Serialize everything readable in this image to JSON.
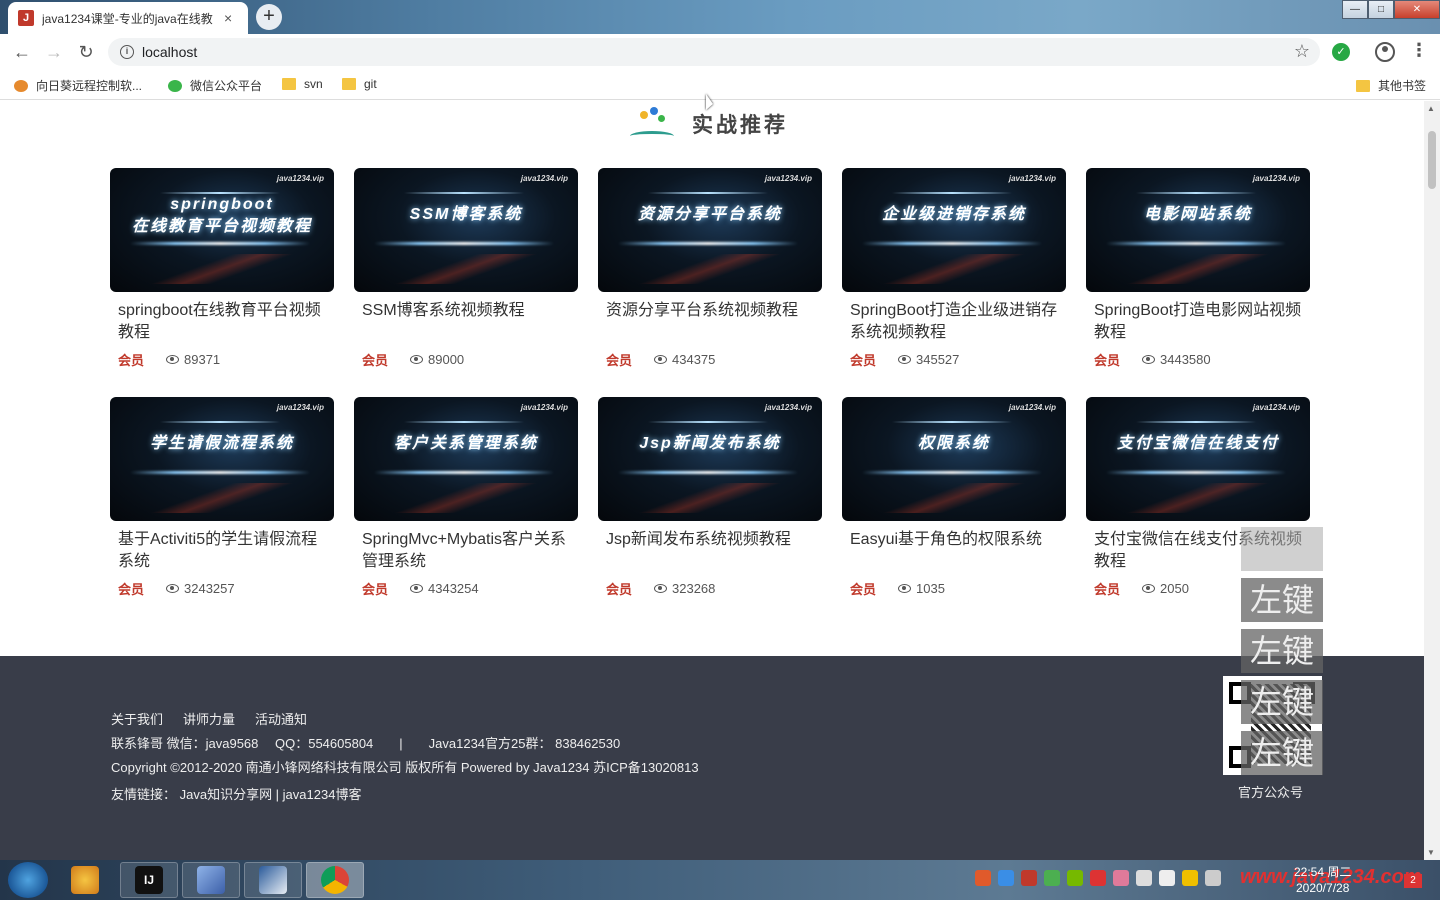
{
  "browser": {
    "tab_title": "java1234课堂-专业的java在线教",
    "tab_favicon": "J",
    "tab_close": "×",
    "new_tab": "+",
    "url": "localhost",
    "window_controls": {
      "minimize": "—",
      "maximize": "□",
      "close": "✕"
    }
  },
  "bookmarks": [
    {
      "label": "向日葵远程控制软...",
      "icon": "sunflower-icon"
    },
    {
      "label": "微信公众平台",
      "icon": "wechat-icon"
    },
    {
      "label": "svn",
      "icon": "folder-icon"
    },
    {
      "label": "git",
      "icon": "folder-icon"
    }
  ],
  "other_bookmarks": "其他书签",
  "section": {
    "title": "实战推荐"
  },
  "courses": [
    {
      "thumb": "springboot\n在线教育平台视频教程",
      "title": "springboot在线教育平台视频教程",
      "badge": "会员",
      "views": "89371"
    },
    {
      "thumb": "SSM博客系统",
      "title": "SSM博客系统视频教程",
      "badge": "会员",
      "views": "89000"
    },
    {
      "thumb": "资源分享平台系统",
      "title": "资源分享平台系统视频教程",
      "badge": "会员",
      "views": "434375"
    },
    {
      "thumb": "企业级进销存系统",
      "title": "SpringBoot打造企业级进销存系统视频教程",
      "badge": "会员",
      "views": "345527"
    },
    {
      "thumb": "电影网站系统",
      "title": "SpringBoot打造电影网站视频教程",
      "badge": "会员",
      "views": "3443580"
    },
    {
      "thumb": "学生请假流程系统",
      "title": "基于Activiti5的学生请假流程系统",
      "badge": "会员",
      "views": "3243257"
    },
    {
      "thumb": "客户关系管理系统",
      "title": "SpringMvc+Mybatis客户关系管理系统",
      "badge": "会员",
      "views": "4343254"
    },
    {
      "thumb": "Jsp新闻发布系统",
      "title": "Jsp新闻发布系统视频教程",
      "badge": "会员",
      "views": "323268"
    },
    {
      "thumb": "权限系统",
      "title": "Easyui基于角色的权限系统",
      "badge": "会员",
      "views": "1035"
    },
    {
      "thumb": "支付宝微信在线支付",
      "title": "支付宝微信在线支付系统视频教程",
      "badge": "会员",
      "views": "2050"
    }
  ],
  "thumb_watermark": "java1234.vip",
  "footer": {
    "links": [
      "关于我们",
      "讲师力量",
      "活动通知"
    ],
    "contact": "联系锋哥 微信：java9568　 QQ：554605804　　|　　Java1234官方25群：  838462530",
    "copyright": "Copyright ©2012-2020 南通小锋网络科技有限公司 版权所有 Powered by Java1234 苏ICP备13020813",
    "friends": "友情链接：  Java知识分享网  |   java1234博客",
    "qr_caption": "官方公众号"
  },
  "overlay_labels": [
    "左键",
    "左键",
    "左键",
    "左键"
  ],
  "taskbar": {
    "apps": [
      {
        "name": "sunflower",
        "label": ""
      },
      {
        "name": "intellij",
        "label": "IJ"
      },
      {
        "name": "seamonkey",
        "label": ""
      },
      {
        "name": "navicat",
        "label": ""
      },
      {
        "name": "chrome",
        "label": ""
      }
    ],
    "time": "22:54 周二",
    "date": "2020/7/28",
    "watermark": "www.java1234.com",
    "notifications": "2"
  }
}
